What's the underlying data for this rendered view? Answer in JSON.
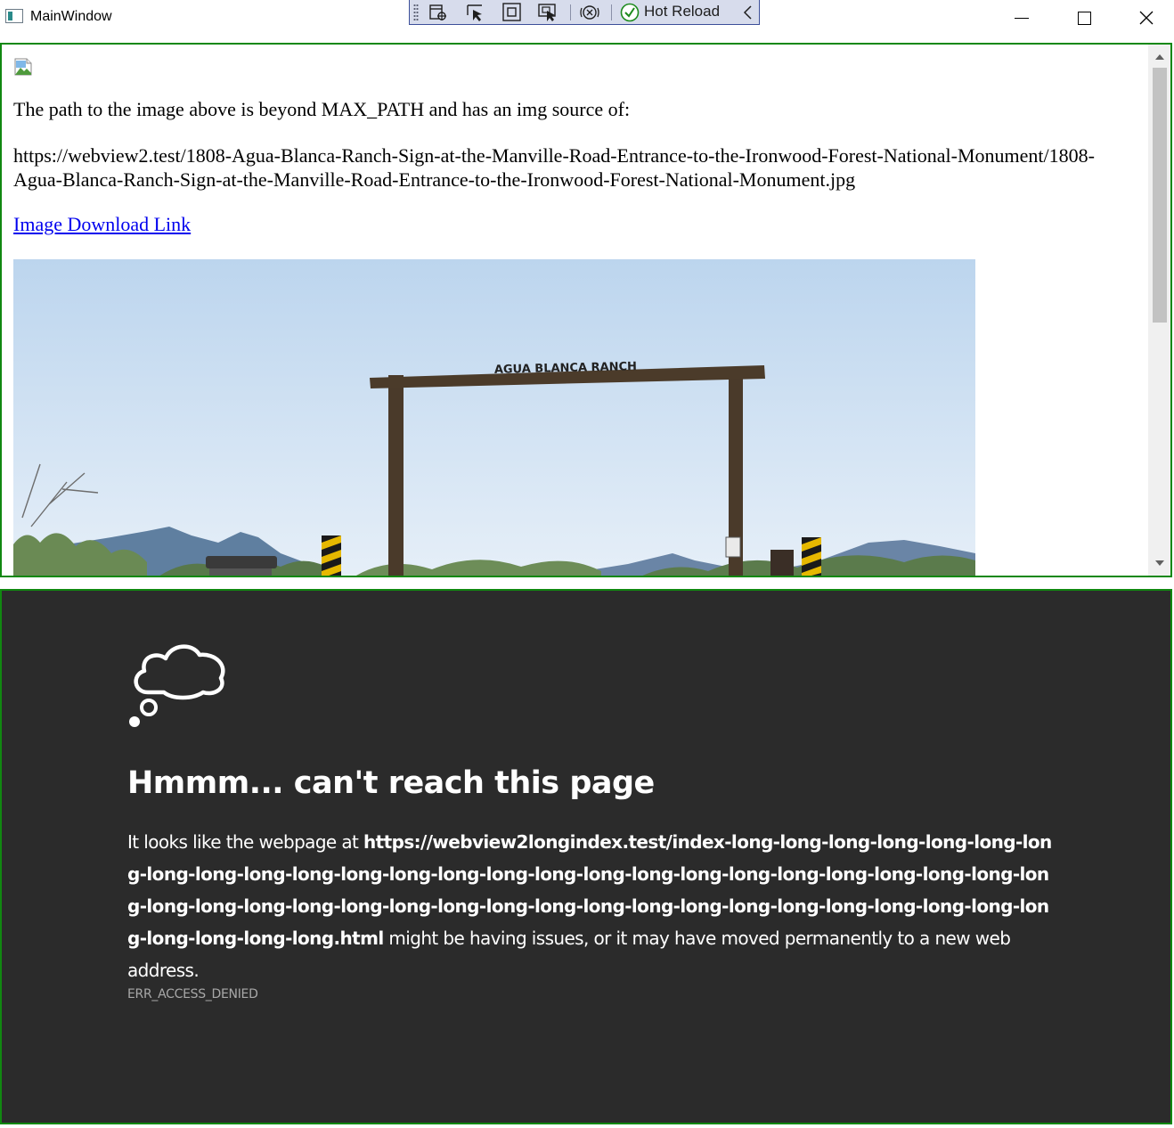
{
  "window": {
    "title": "MainWindow"
  },
  "toolbar": {
    "hot_reload_label": "Hot Reload",
    "icons": [
      "select-element-icon",
      "select-pointer-icon",
      "display-layout-adorners-icon",
      "track-focused-element-icon",
      "binding-failures-icon",
      "hot-reload-status-icon",
      "collapse-chevron-icon"
    ]
  },
  "top_page": {
    "description": "The path to the image above is beyond MAX_PATH and has an img source of:",
    "img_source": "https://webview2.test/1808-Agua-Blanca-Ranch-Sign-at-the-Manville-Road-Entrance-to-the-Ironwood-Forest-National-Monument/1808-Agua-Blanca-Ranch-Sign-at-the-Manville-Road-Entrance-to-the-Ironwood-Forest-National-Monument.jpg",
    "download_link": "Image Download Link",
    "photo_sign_text": "AGUA BLANCA RANCH"
  },
  "error_page": {
    "title": "Hmmm... can't reach this page",
    "body_prefix": "It looks like the webpage at ",
    "url": "https://webview2longindex.test/index-long-long-long-long-long-long-long-long-long-long-long-long-long-long-long-long-long-long-long-long-long-long-long-long-long-long-long-long-long-long-long-long-long-long-long-long-long-long-long-long-long-long-long-long-long-long-long-long-long.html",
    "body_suffix": " might be having issues, or it may have moved permanently to a new web address.",
    "error_code": "ERR_ACCESS_DENIED"
  },
  "colors": {
    "frame_border": "#118811",
    "error_background": "#2b2b2b",
    "link": "#0000ee",
    "toolbar_background": "#d7dcec"
  }
}
